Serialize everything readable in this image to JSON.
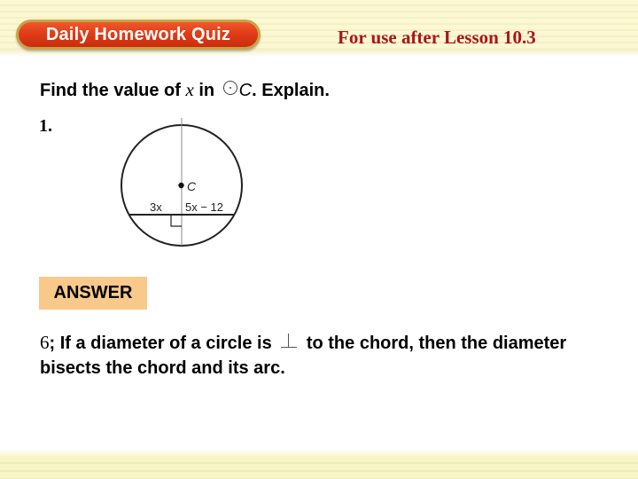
{
  "header": {
    "quiz_title": "Daily Homework Quiz",
    "lesson_label": "For use after Lesson 10.3"
  },
  "prompt": {
    "pre": "Find the value of ",
    "variable": "x",
    "mid": " in ",
    "circle_symbol": "circle-dot-icon",
    "circle_name": "C",
    "post": ". Explain."
  },
  "problem": {
    "number": "1.",
    "figure": {
      "center_label": "C",
      "left_segment": "3x",
      "right_segment": "5x − 12"
    }
  },
  "answer": {
    "badge": "ANSWER",
    "value": "6",
    "text_part1": "; If a diameter of a circle is ",
    "symbol": "perpendicular-icon",
    "text_part2": " to the chord, then the diameter bisects the chord and its arc."
  },
  "colors": {
    "quiz_pill": "#e03c17",
    "lesson_label": "#a8161a",
    "answer_badge": "#f9c98b",
    "header_band": "#fbf8d2"
  }
}
